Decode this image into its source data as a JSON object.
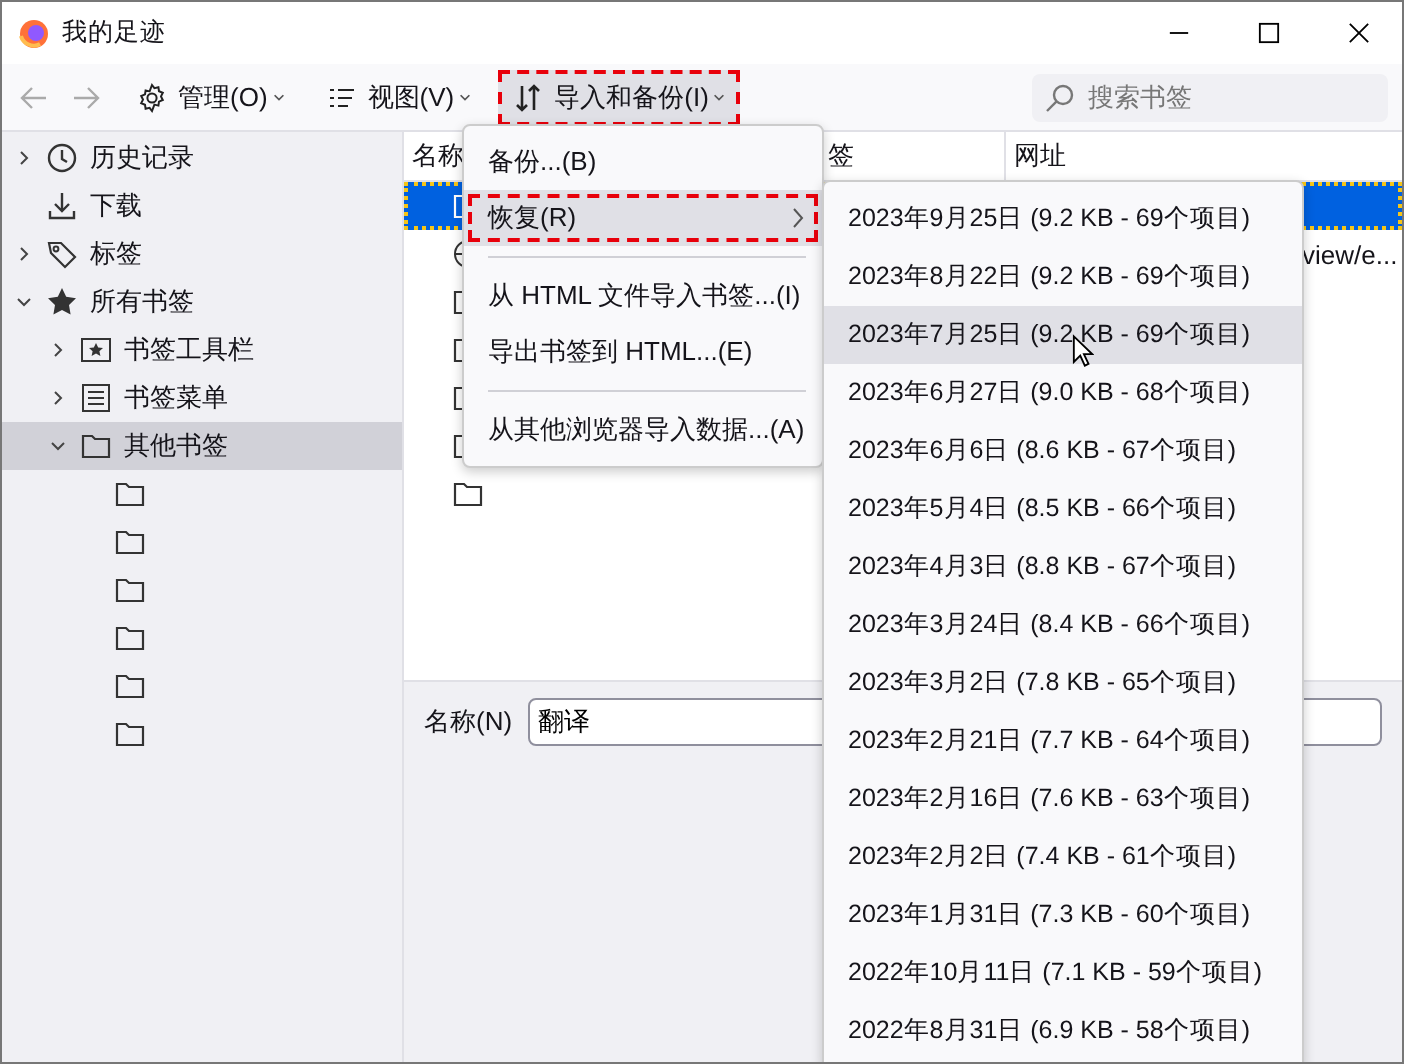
{
  "window": {
    "title": "我的足迹"
  },
  "toolbar": {
    "menus": [
      {
        "label": "管理(O)",
        "kind": "manage",
        "open": false,
        "annotated": false
      },
      {
        "label": "视图(V)",
        "kind": "view",
        "open": false,
        "annotated": false
      },
      {
        "label": "导入和备份(I)",
        "kind": "import",
        "open": true,
        "annotated": true
      }
    ]
  },
  "search": {
    "placeholder": "搜索书签"
  },
  "sidebar": {
    "items": [
      {
        "label": "历史记录",
        "kind": "history",
        "expanded": false,
        "selected": false
      },
      {
        "label": "下载",
        "kind": "downloads",
        "selected": false
      },
      {
        "label": "标签",
        "kind": "tags",
        "expanded": false,
        "selected": false
      },
      {
        "label": "所有书签",
        "kind": "bookmarks",
        "expanded": true,
        "selected": false,
        "children": [
          {
            "label": "书签工具栏",
            "kind": "toolbar",
            "expanded": false,
            "selected": false
          },
          {
            "label": "书签菜单",
            "kind": "menu",
            "expanded": false,
            "selected": false
          },
          {
            "label": "其他书签",
            "kind": "folder",
            "expanded": true,
            "selected": true,
            "children": [
              {
                "kind": "folder",
                "selected": false
              },
              {
                "kind": "folder",
                "selected": false
              },
              {
                "kind": "folder",
                "selected": false
              },
              {
                "kind": "folder",
                "selected": false
              },
              {
                "kind": "folder",
                "selected": false
              },
              {
                "kind": "folder",
                "selected": false
              }
            ]
          }
        ]
      }
    ]
  },
  "table": {
    "columns": [
      "名称",
      "签",
      "网址"
    ],
    "rows": [
      {
        "kind": "folder",
        "selected": true
      },
      {
        "kind": "link",
        "url": "view/e...",
        "selected": false
      },
      {
        "kind": "folder",
        "selected": false
      },
      {
        "kind": "folder",
        "selected": false
      },
      {
        "kind": "folder",
        "selected": false
      },
      {
        "kind": "folder",
        "selected": false
      },
      {
        "kind": "folder",
        "selected": false
      }
    ]
  },
  "details": {
    "name_label": "名称(N)",
    "name_value": "翻译"
  },
  "menu": {
    "items": [
      {
        "kind": "item",
        "label": "备份...(B)",
        "highlighted": false,
        "annotated": false,
        "submenu": false
      },
      {
        "kind": "item",
        "label": "恢复(R)",
        "highlighted": true,
        "annotated": true,
        "submenu": true
      },
      {
        "kind": "separator"
      },
      {
        "kind": "item",
        "label": "从 HTML 文件导入书签...(I)",
        "highlighted": false,
        "annotated": false,
        "submenu": false
      },
      {
        "kind": "item",
        "label": "导出书签到 HTML...(E)",
        "highlighted": false,
        "annotated": false,
        "submenu": false
      },
      {
        "kind": "separator"
      },
      {
        "kind": "item",
        "label": "从其他浏览器导入数据...(A)",
        "highlighted": false,
        "annotated": false,
        "submenu": false
      }
    ]
  },
  "submenu": {
    "items": [
      {
        "label": "2023年9月25日 (9.2 KB - 69个项目)",
        "highlighted": false
      },
      {
        "label": "2023年8月22日 (9.2 KB - 69个项目)",
        "highlighted": false
      },
      {
        "label": "2023年7月25日 (9.2 KB - 69个项目)",
        "highlighted": true
      },
      {
        "label": "2023年6月27日 (9.0 KB - 68个项目)",
        "highlighted": false
      },
      {
        "label": "2023年6月6日 (8.6 KB - 67个项目)",
        "highlighted": false
      },
      {
        "label": "2023年5月4日 (8.5 KB - 66个项目)",
        "highlighted": false
      },
      {
        "label": "2023年4月3日 (8.8 KB - 67个项目)",
        "highlighted": false
      },
      {
        "label": "2023年3月24日 (8.4 KB - 66个项目)",
        "highlighted": false
      },
      {
        "label": "2023年3月2日 (7.8 KB - 65个项目)",
        "highlighted": false
      },
      {
        "label": "2023年2月21日 (7.7 KB - 64个项目)",
        "highlighted": false
      },
      {
        "label": "2023年2月16日 (7.6 KB - 63个项目)",
        "highlighted": false
      },
      {
        "label": "2023年2月2日 (7.4 KB - 61个项目)",
        "highlighted": false
      },
      {
        "label": "2023年1月31日 (7.3 KB - 60个项目)",
        "highlighted": false
      },
      {
        "label": "2022年10月11日 (7.1 KB - 59个项目)",
        "highlighted": false
      },
      {
        "label": "2022年8月31日 (6.9 KB - 58个项目)",
        "highlighted": false
      }
    ]
  }
}
